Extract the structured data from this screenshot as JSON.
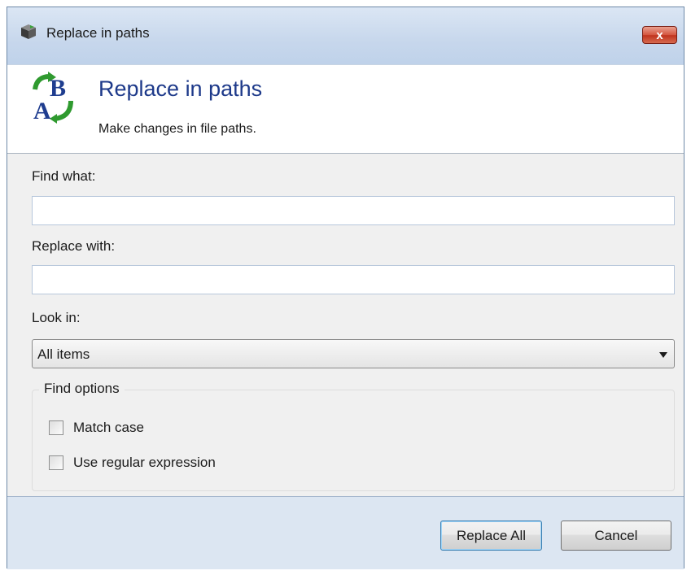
{
  "window": {
    "title": "Replace in paths",
    "close_label": "x",
    "app_icon": "cube-icon"
  },
  "header": {
    "title": "Replace in paths",
    "subtitle": "Make changes in file paths.",
    "logo_icon": "ab-replace-icon"
  },
  "form": {
    "find_label": "Find what:",
    "find_value": "",
    "replace_label": "Replace with:",
    "replace_value": "",
    "look_in_label": "Look in:",
    "look_in_value": "All items",
    "options": {
      "legend": "Find options",
      "match_case": {
        "label": "Match case",
        "checked": false
      },
      "use_regex": {
        "label": "Use regular expression",
        "checked": false
      }
    }
  },
  "buttons": {
    "replace_all": "Replace All",
    "cancel": "Cancel"
  },
  "colors": {
    "header_title": "#1e3a8a",
    "close_button": "#c0321c",
    "frame": "#dce6f2"
  }
}
